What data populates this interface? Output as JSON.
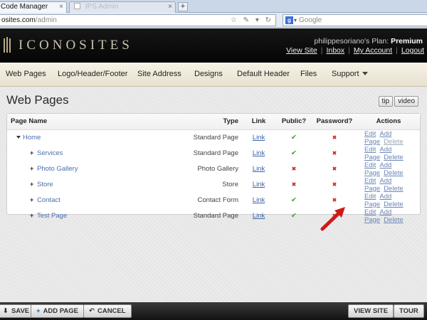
{
  "browser": {
    "tabs": [
      {
        "label": "Code Manager"
      },
      {
        "label": "IPS Admin"
      }
    ],
    "new_tab": "+",
    "tab_close": "×",
    "url_prefix": "osites.com",
    "url_path": "/admin",
    "url_icons": "☆ ✎ ▾ ↻",
    "search_engine": "g",
    "search_caret": "▾",
    "search_placeholder": "Google"
  },
  "header": {
    "logo_text": "ICONOSITES",
    "plan_prefix": "philippesoriano's Plan:",
    "plan_name": "Premium",
    "links": [
      "View Site",
      "Inbox",
      "My Account",
      "Logout"
    ],
    "separator": "|"
  },
  "menu": {
    "items": [
      "Web Pages",
      "Logo/Header/Footer",
      "Site Address",
      "Designs",
      "Default Header",
      "Files",
      "Support"
    ]
  },
  "main": {
    "title": "Web Pages",
    "tip_label": "tip",
    "video_label": "video",
    "columns": [
      "Page Name",
      "Type",
      "Link",
      "Public?",
      "Password?",
      "Actions"
    ],
    "rows": [
      {
        "name": "Home",
        "type": "Standard Page",
        "link": "Link",
        "public": "✔",
        "password": "✖",
        "actions": [
          "Edit",
          "Add Page",
          "Delete"
        ]
      },
      {
        "name": "Services",
        "type": "Standard Page",
        "link": "Link",
        "public": "✔",
        "password": "✖",
        "actions": [
          "Edit",
          "Add Page",
          "Delete"
        ]
      },
      {
        "name": "Photo Gallery",
        "type": "Photo Gallery",
        "link": "Link",
        "public": "✖",
        "password": "✖",
        "actions": [
          "Edit",
          "Add Page",
          "Delete"
        ]
      },
      {
        "name": "Store",
        "type": "Store",
        "link": "Link",
        "public": "✖",
        "password": "✖",
        "actions": [
          "Edit",
          "Add Page",
          "Delete"
        ]
      },
      {
        "name": "Contact",
        "type": "Contact Form",
        "link": "Link",
        "public": "✔",
        "password": "✖",
        "actions": [
          "Edit",
          "Add Page",
          "Delete"
        ]
      },
      {
        "name": "Test Page",
        "type": "Standard Page",
        "link": "Link",
        "public": "✔",
        "password": "✖",
        "actions": [
          "Edit",
          "Add Page",
          "Delete"
        ]
      }
    ]
  },
  "footer": {
    "save_label": "SAVE",
    "save_icon": "⬇",
    "add_page_label": "ADD PAGE",
    "add_icon": "+",
    "cancel_label": "CANCEL",
    "cancel_icon": "↶",
    "view_site_label": "VIEW SITE",
    "tour_label": "TOUR"
  },
  "colors": {
    "accent_link": "#3e63a8",
    "check_green": "#3a9a2a",
    "cross_red": "#cc2222",
    "arrow_red": "#d01818"
  }
}
